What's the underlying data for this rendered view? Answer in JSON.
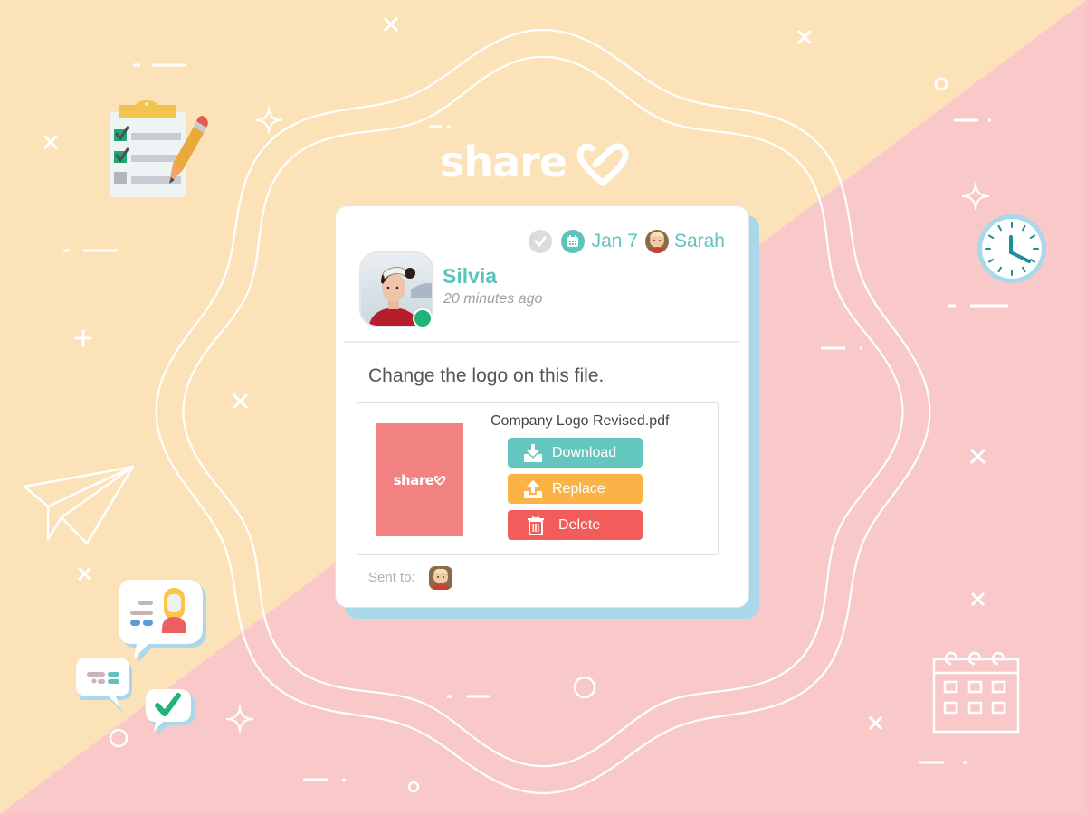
{
  "brand": {
    "name": "share",
    "logo_icon": "heart-icon"
  },
  "colors": {
    "background_top": "#fce2b8",
    "background_bottom": "#f9c8c8",
    "accent_teal": "#5cc4bb",
    "download": "#64c7bf",
    "replace": "#fbb347",
    "delete": "#f25d5b",
    "online": "#1fb37a",
    "card_shadow": "#a8d8ea"
  },
  "card": {
    "meta": {
      "status_icon": "check-circle-icon",
      "date_icon": "calendar-icon",
      "date": "Jan 7",
      "assignee": "Sarah"
    },
    "author": {
      "name": "Silvia",
      "time": "20 minutes ago",
      "status": "online"
    },
    "message": "Change the logo on this file.",
    "attachment": {
      "file_name": "Company Logo Revised.pdf",
      "thumbnail_text": "share",
      "buttons": {
        "download": "Download",
        "replace": "Replace",
        "delete": "Delete"
      }
    },
    "sent_to_label": "Sent to:"
  },
  "decorations": {
    "icons": [
      "clipboard-checklist-icon",
      "pencil-icon",
      "paper-plane-icon",
      "chat-bubbles-icon",
      "clock-icon",
      "calendar-outline-icon",
      "sparkle-icon",
      "cross-icon",
      "circle-icon"
    ]
  }
}
